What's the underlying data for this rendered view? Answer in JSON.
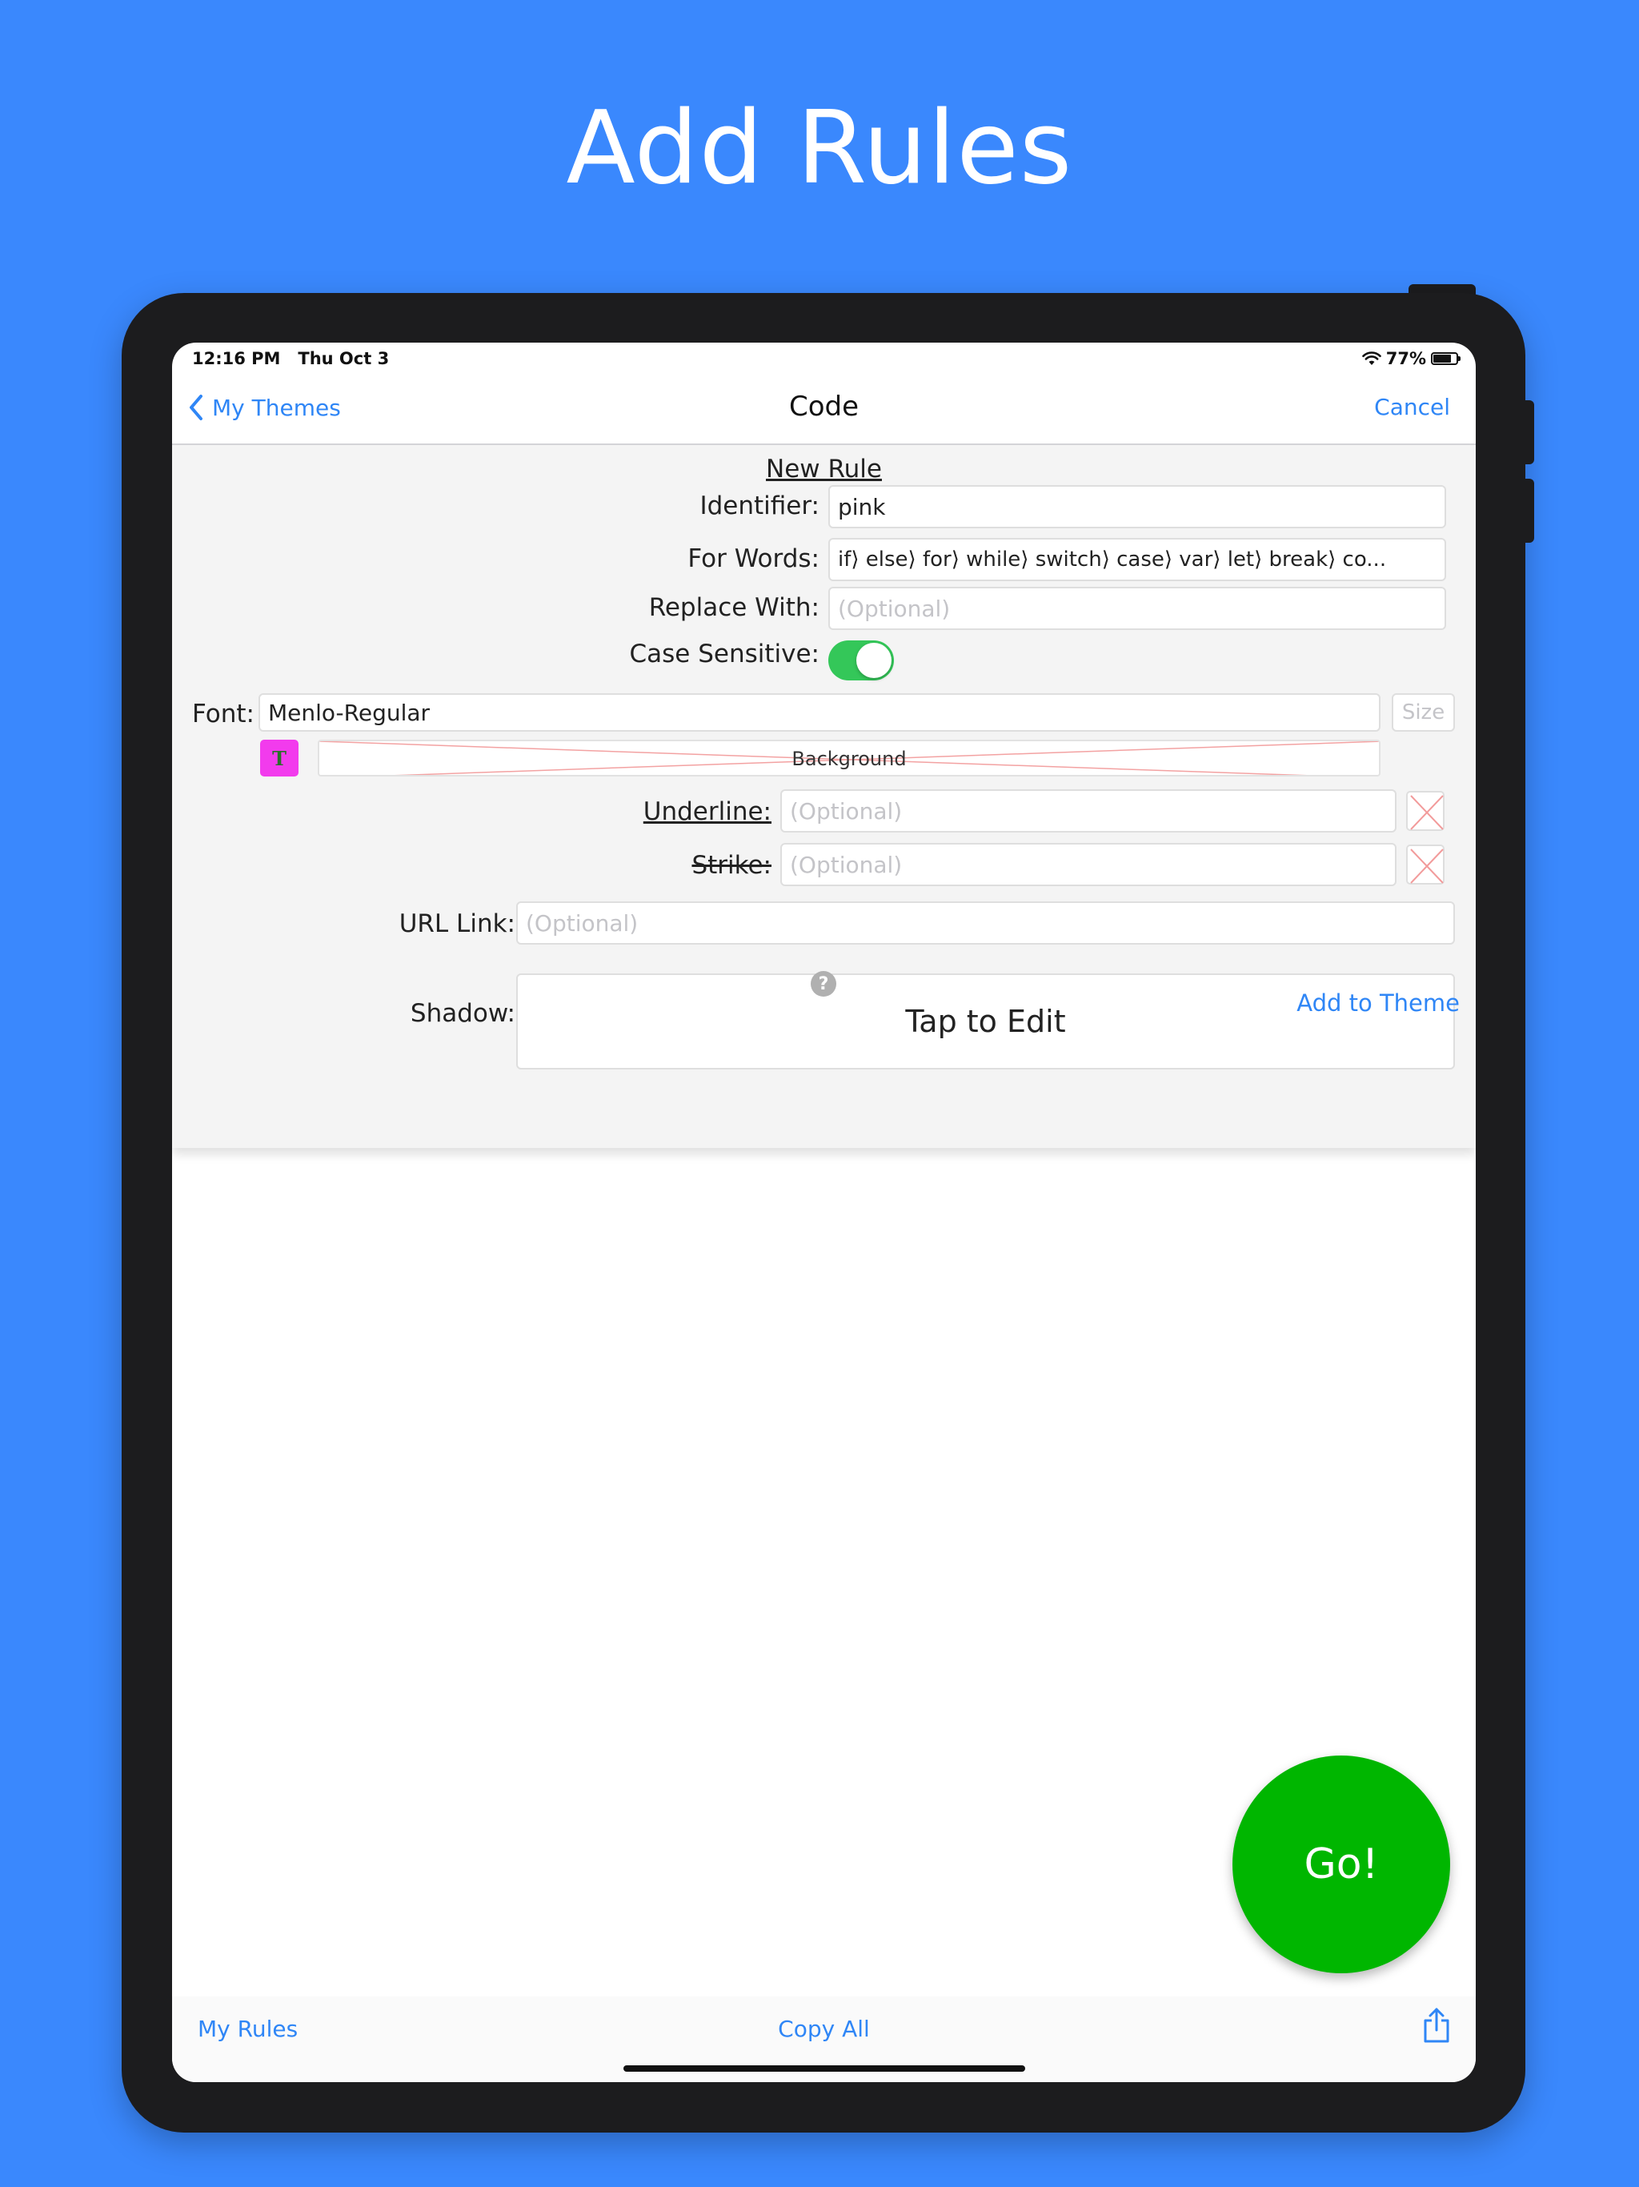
{
  "headline": "Add Rules",
  "status_bar": {
    "time": "12:16 PM",
    "date": "Thu Oct 3",
    "battery": "77%"
  },
  "nav": {
    "back_label": "My Themes",
    "title": "Code",
    "cancel_label": "Cancel"
  },
  "form": {
    "title": "New Rule",
    "identifier": {
      "label": "Identifier:",
      "value": "pink"
    },
    "for_words": {
      "label": "For Words:",
      "value": "if⟩  else⟩  for⟩  while⟩  switch⟩  case⟩  var⟩  let⟩  break⟩  co..."
    },
    "replace_with": {
      "label": "Replace With:",
      "placeholder": "(Optional)"
    },
    "case_sensitive": {
      "label": "Case Sensitive:",
      "on": true
    },
    "font": {
      "label": "Font:",
      "value": "Menlo-Regular",
      "size_placeholder": "Size"
    },
    "text_color": {
      "glyph": "T",
      "color": "#f23bed"
    },
    "background": {
      "label": "Background"
    },
    "underline": {
      "label": "Underline:",
      "placeholder": "(Optional)"
    },
    "strike": {
      "label": "Strike:",
      "placeholder": "(Optional)"
    },
    "url_link": {
      "label": "URL Link:",
      "placeholder": "(Optional)"
    },
    "shadow": {
      "label": "Shadow:",
      "button": "Tap to Edit"
    },
    "help_glyph": "?",
    "add_to_theme": "Add to Theme"
  },
  "go_button": "Go!",
  "toolbar": {
    "my_rules": "My Rules",
    "copy_all": "Copy All",
    "share_icon": "share-icon"
  },
  "colors": {
    "background": "#3a88fd",
    "accent": "#2f86f6",
    "go": "#00b600",
    "toggle_on": "#34c759"
  }
}
